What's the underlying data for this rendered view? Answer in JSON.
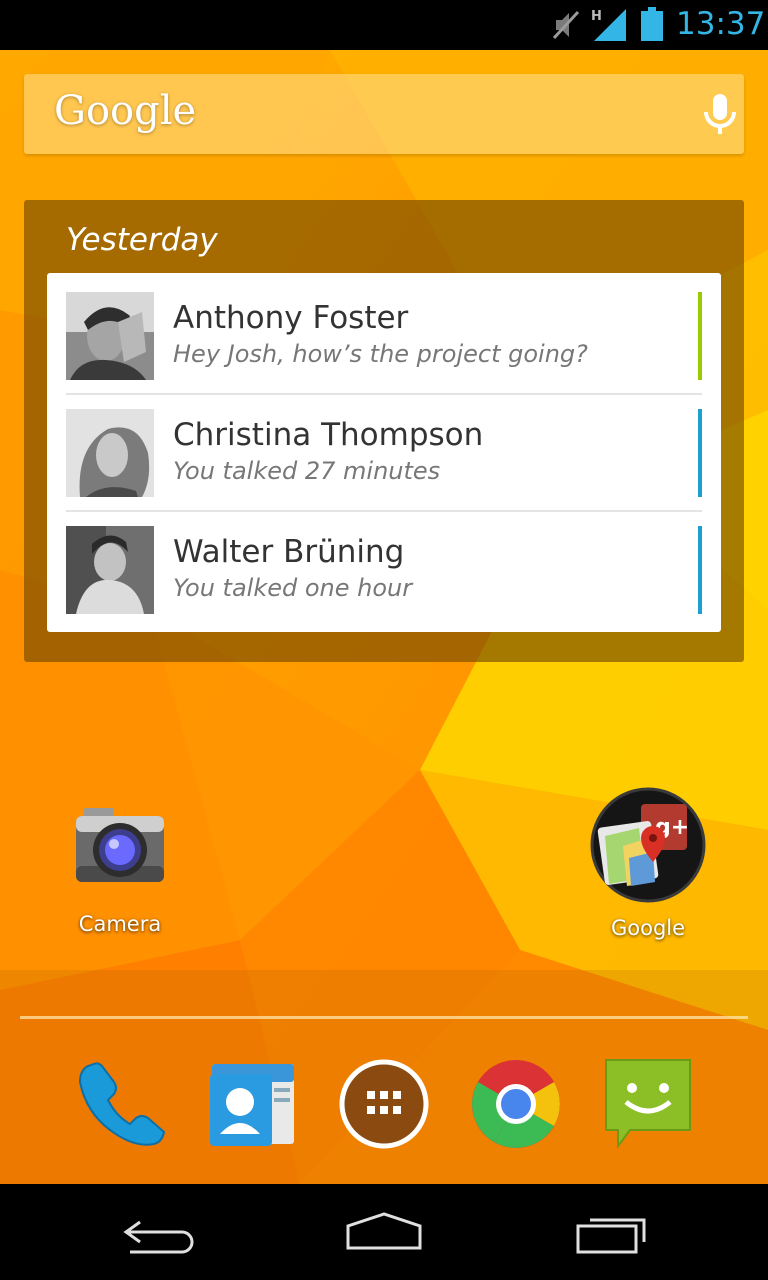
{
  "status_bar": {
    "time": "13:37",
    "network_type": "H",
    "icons": [
      "mute-icon",
      "signal-icon",
      "battery-icon"
    ],
    "accent_color": "#33b5e5"
  },
  "search": {
    "logo": "Google",
    "icon": "microphone-icon"
  },
  "widget": {
    "title": "Yesterday",
    "contacts": [
      {
        "name": "Anthony Foster",
        "detail": "Hey Josh, how’s the project going?",
        "indicator_color": "#99cc00"
      },
      {
        "name": "Christina Thompson",
        "detail": "You talked 27 minutes",
        "indicator_color": "#1e9fd2"
      },
      {
        "name": "Walter Brüning",
        "detail": "You talked one hour",
        "indicator_color": "#1e9fd2"
      }
    ]
  },
  "shortcuts": [
    {
      "label": "Camera",
      "icon": "camera-icon"
    },
    {
      "label": "Google",
      "icon": "google-folder-icon"
    }
  ],
  "dock": [
    "phone-icon",
    "contacts-icon",
    "app-drawer-icon",
    "chrome-icon",
    "messaging-icon"
  ],
  "navigation": [
    "back-icon",
    "home-icon",
    "recents-icon"
  ],
  "colors": {
    "wallpaper_primary": "#ff9a00",
    "wallpaper_light": "#ffd000",
    "widget_background": "#6e4600"
  }
}
